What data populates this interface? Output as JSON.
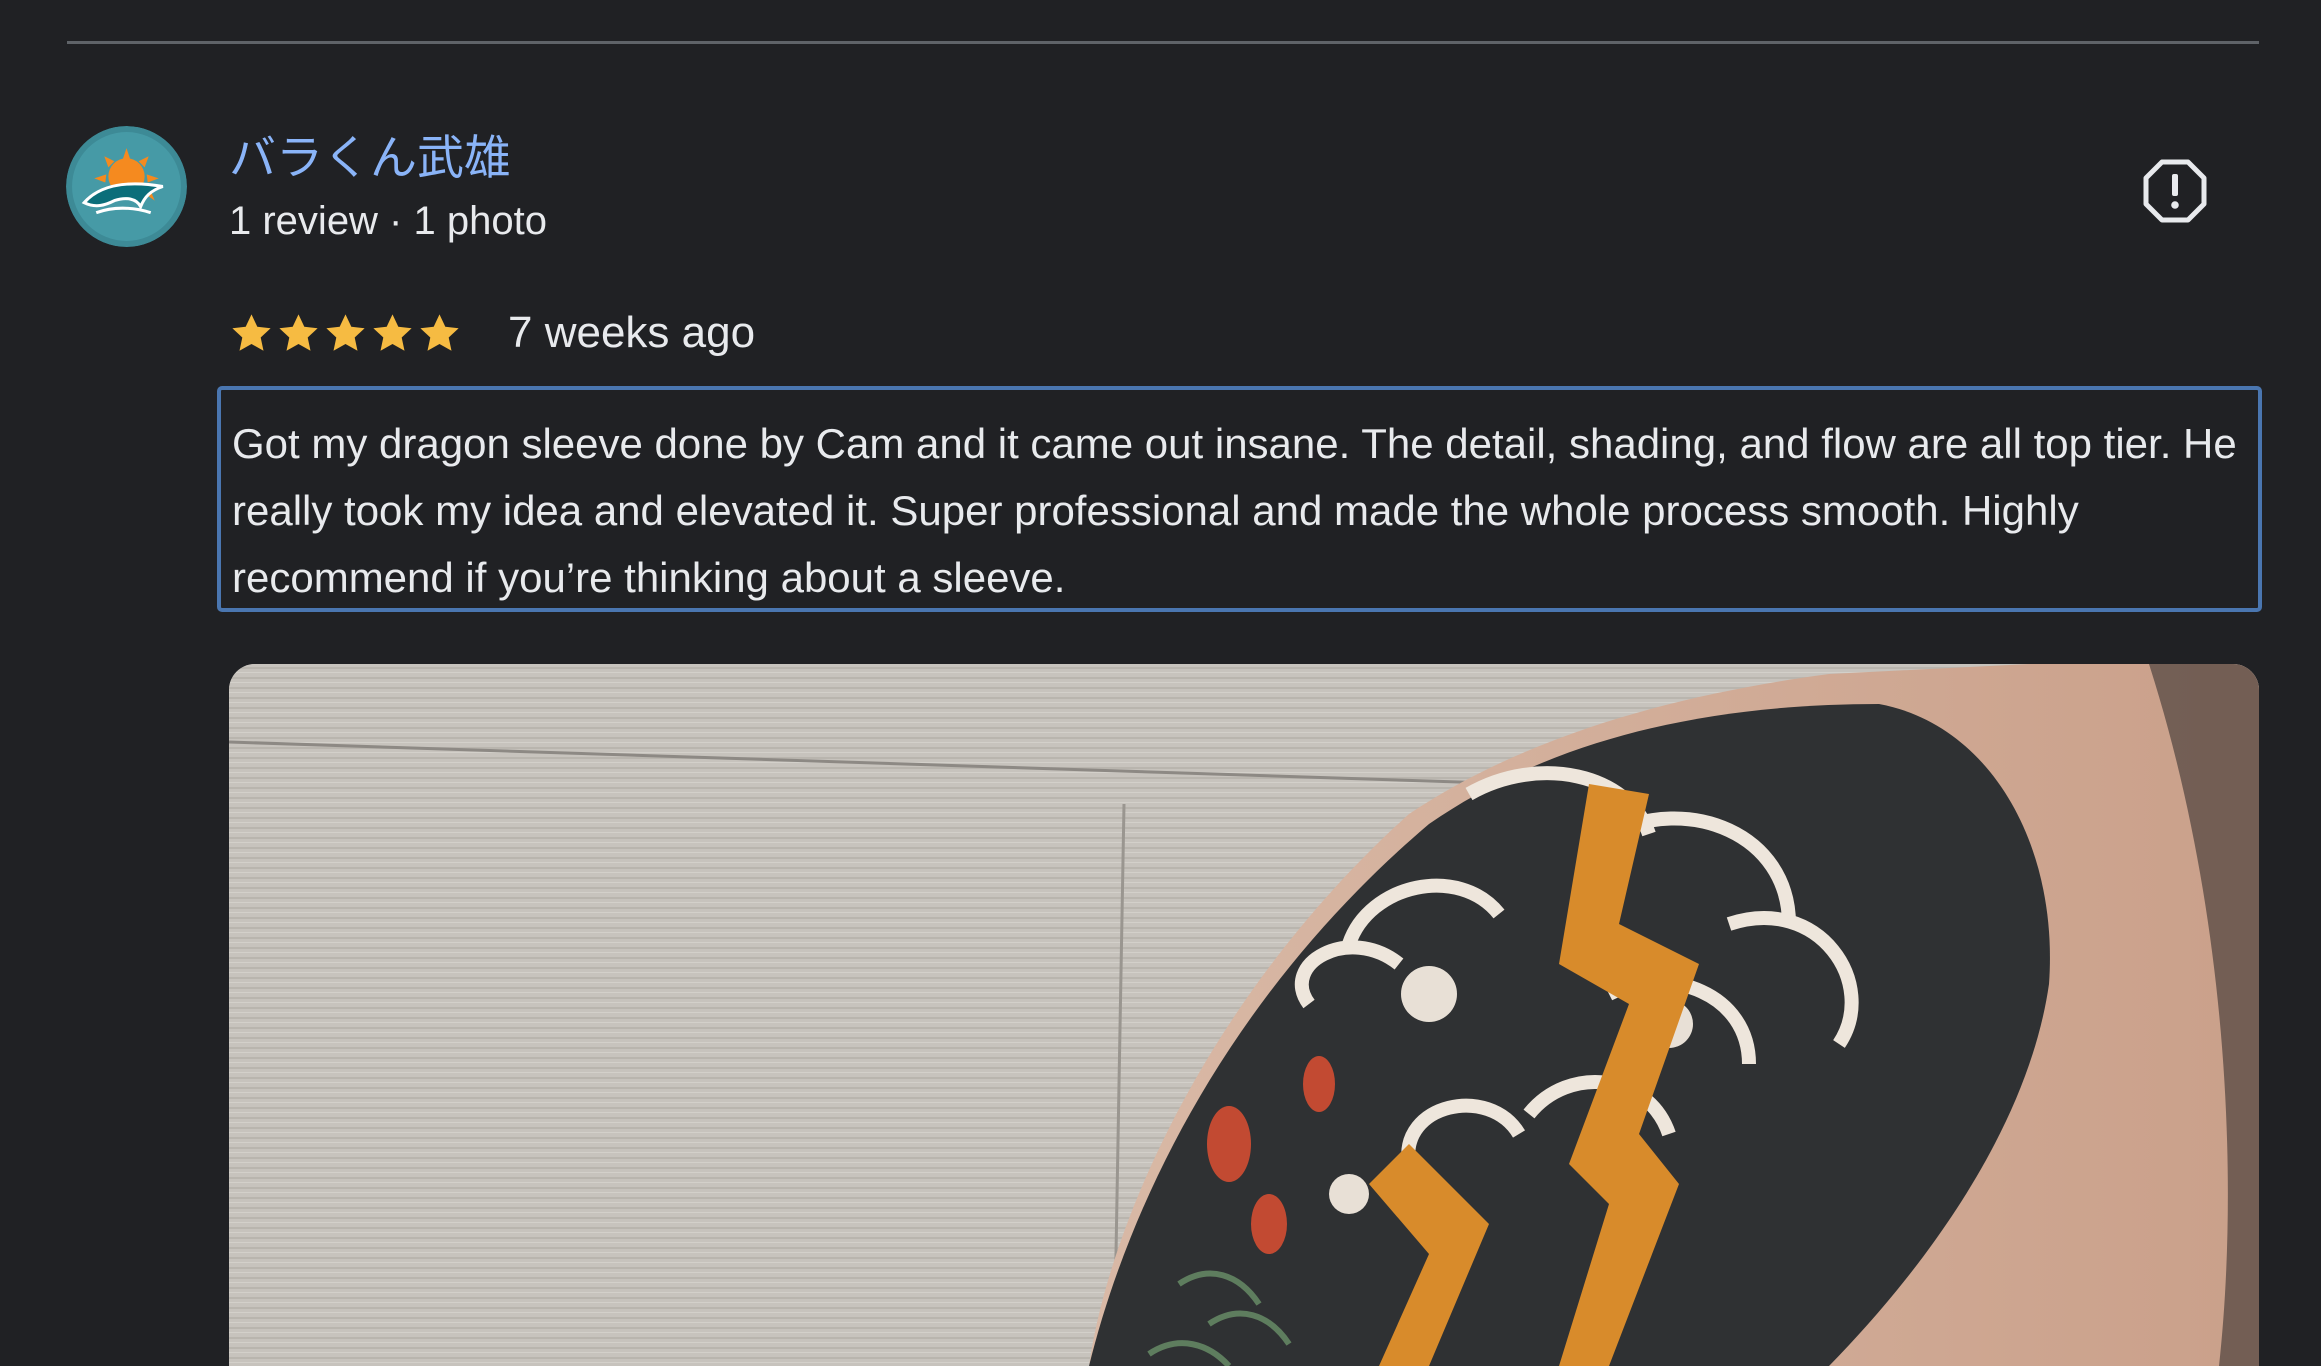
{
  "review": {
    "reviewer_name": "バラくん武雄",
    "reviewer_meta": "1 review · 1 photo",
    "rating": 5,
    "rating_max": 5,
    "date": "7 weeks ago",
    "text": "Got my dragon sleeve done by Cam and it came out insane. The detail, shading, and flow are all top tier. He really took my idea and elevated it. Super professional and made the whole process smooth. Highly recommend if you’re thinking about a sleeve."
  },
  "icons": {
    "avatar": "dolphin-logo-icon",
    "report": "report-octagon-icon",
    "star": "star-icon"
  },
  "colors": {
    "background": "#202124",
    "name_link": "#8ab4f8",
    "text": "#e8eaed",
    "star": "#f6bb42",
    "focus_border": "#4a76b0",
    "divider": "#5f6368"
  }
}
